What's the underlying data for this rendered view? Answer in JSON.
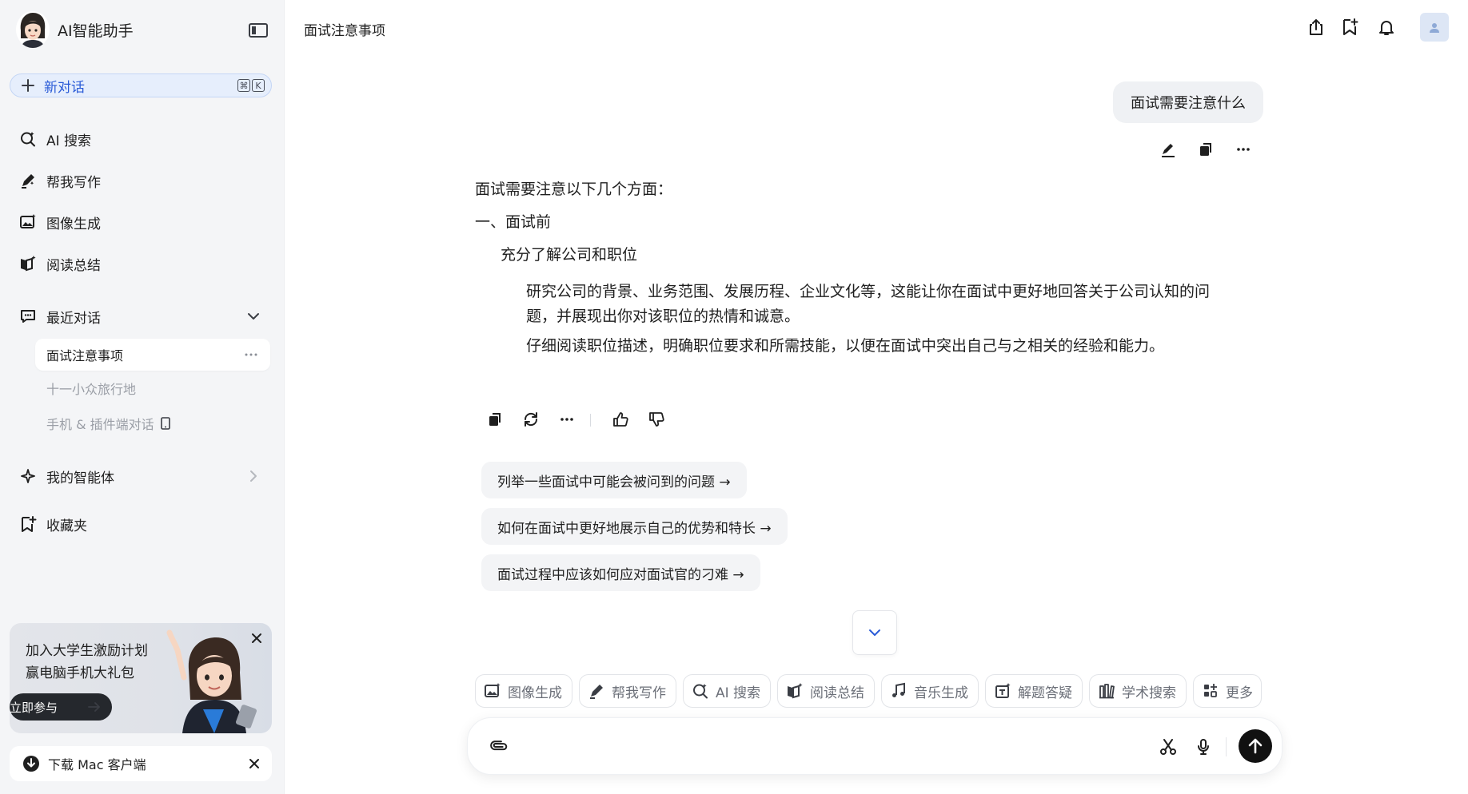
{
  "sidebar": {
    "app_name": "AI智能助手",
    "new_chat": {
      "label": "新对话",
      "shortcut": [
        "⌘",
        "K"
      ]
    },
    "nav": [
      {
        "label": "AI 搜索",
        "icon": "ai-search-icon"
      },
      {
        "label": "帮我写作",
        "icon": "pen-icon"
      },
      {
        "label": "图像生成",
        "icon": "image-gen-icon"
      },
      {
        "label": "阅读总结",
        "icon": "read-summary-icon"
      }
    ],
    "recent": {
      "label": "最近对话",
      "items": [
        {
          "label": "面试注意事项",
          "active": true
        },
        {
          "label": "十一小众旅行地",
          "active": false
        },
        {
          "label": "手机 & 插件端对话",
          "active": false
        }
      ]
    },
    "agents": {
      "label": "我的智能体"
    },
    "favorites": {
      "label": "收藏夹"
    },
    "promo": {
      "line1": "加入大学生激励计划",
      "line2": "赢电脑手机大礼包",
      "button": "立即参与"
    },
    "download": {
      "label": "下载 Mac 客户端"
    }
  },
  "main": {
    "title": "面试注意事项",
    "user_message": "面试需要注意什么",
    "answer": {
      "intro": "面试需要注意以下几个方面：",
      "section_title": "一、面试前",
      "sub_title": "充分了解公司和职位",
      "para1_line1": "研究公司的背景、业务范围、发展历程、企业文化等，这能让你在面试中更好地回答关于公司认知的问",
      "para1_line2": "题，并展现出你对该职位的热情和诚意。",
      "para2": "仔细阅读职位描述，明确职位要求和所需技能，以便在面试中突出自己与之相关的经验和能力。"
    },
    "suggestions": [
      "列举一些面试中可能会被问到的问题 →",
      "如何在面试中更好地展示自己的优势和特长 →",
      "面试过程中应该如何应对面试官的刁难 →"
    ],
    "tools": [
      {
        "label": "图像生成",
        "icon": "image-gen-icon"
      },
      {
        "label": "帮我写作",
        "icon": "pen-icon"
      },
      {
        "label": "AI 搜索",
        "icon": "ai-search-icon"
      },
      {
        "label": "阅读总结",
        "icon": "read-summary-icon"
      },
      {
        "label": "音乐生成",
        "icon": "music-icon"
      },
      {
        "label": "解题答疑",
        "icon": "solve-icon"
      },
      {
        "label": "学术搜索",
        "icon": "academic-icon"
      },
      {
        "label": "更多",
        "icon": "more-apps-icon"
      }
    ]
  },
  "colors": {
    "accent": "#2a5bd7",
    "sidebar_bg": "#f4f5f7",
    "send_button": "#111111"
  }
}
